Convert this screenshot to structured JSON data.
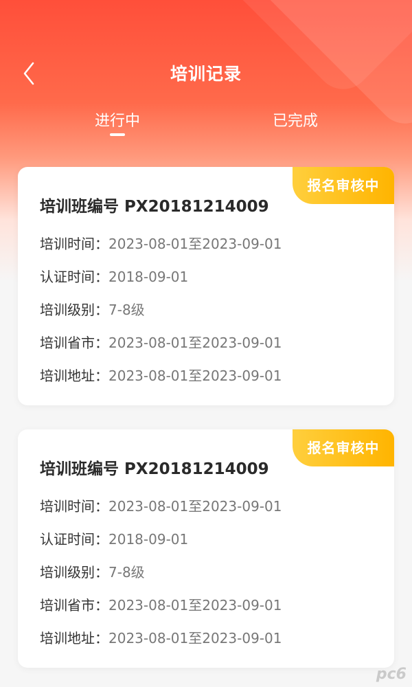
{
  "header": {
    "title": "培训记录",
    "back_icon": "chevron-left-icon"
  },
  "tabs": [
    {
      "label": "进行中",
      "active": true
    },
    {
      "label": "已完成",
      "active": false
    }
  ],
  "records": [
    {
      "badge": "报名审核中",
      "title": "培训班编号 PX20181214009",
      "fields": [
        {
          "label": "培训时间：",
          "value": "2023-08-01至2023-09-01"
        },
        {
          "label": "认证时间：",
          "value": "2018-09-01"
        },
        {
          "label": "培训级别：",
          "value": "7-8级"
        },
        {
          "label": "培训省市：",
          "value": "2023-08-01至2023-09-01"
        },
        {
          "label": "培训地址：",
          "value": "2023-08-01至2023-09-01"
        }
      ]
    },
    {
      "badge": "报名审核中",
      "title": "培训班编号 PX20181214009",
      "fields": [
        {
          "label": "培训时间：",
          "value": "2023-08-01至2023-09-01"
        },
        {
          "label": "认证时间：",
          "value": "2018-09-01"
        },
        {
          "label": "培训级别：",
          "value": "7-8级"
        },
        {
          "label": "培训省市：",
          "value": "2023-08-01至2023-09-01"
        },
        {
          "label": "培训地址：",
          "value": "2023-08-01至2023-09-01"
        }
      ]
    }
  ],
  "colors": {
    "header_red": "#ff4f3a",
    "badge_yellow": "#ffb400",
    "background": "#f6f6f6"
  },
  "watermark": "pc6"
}
